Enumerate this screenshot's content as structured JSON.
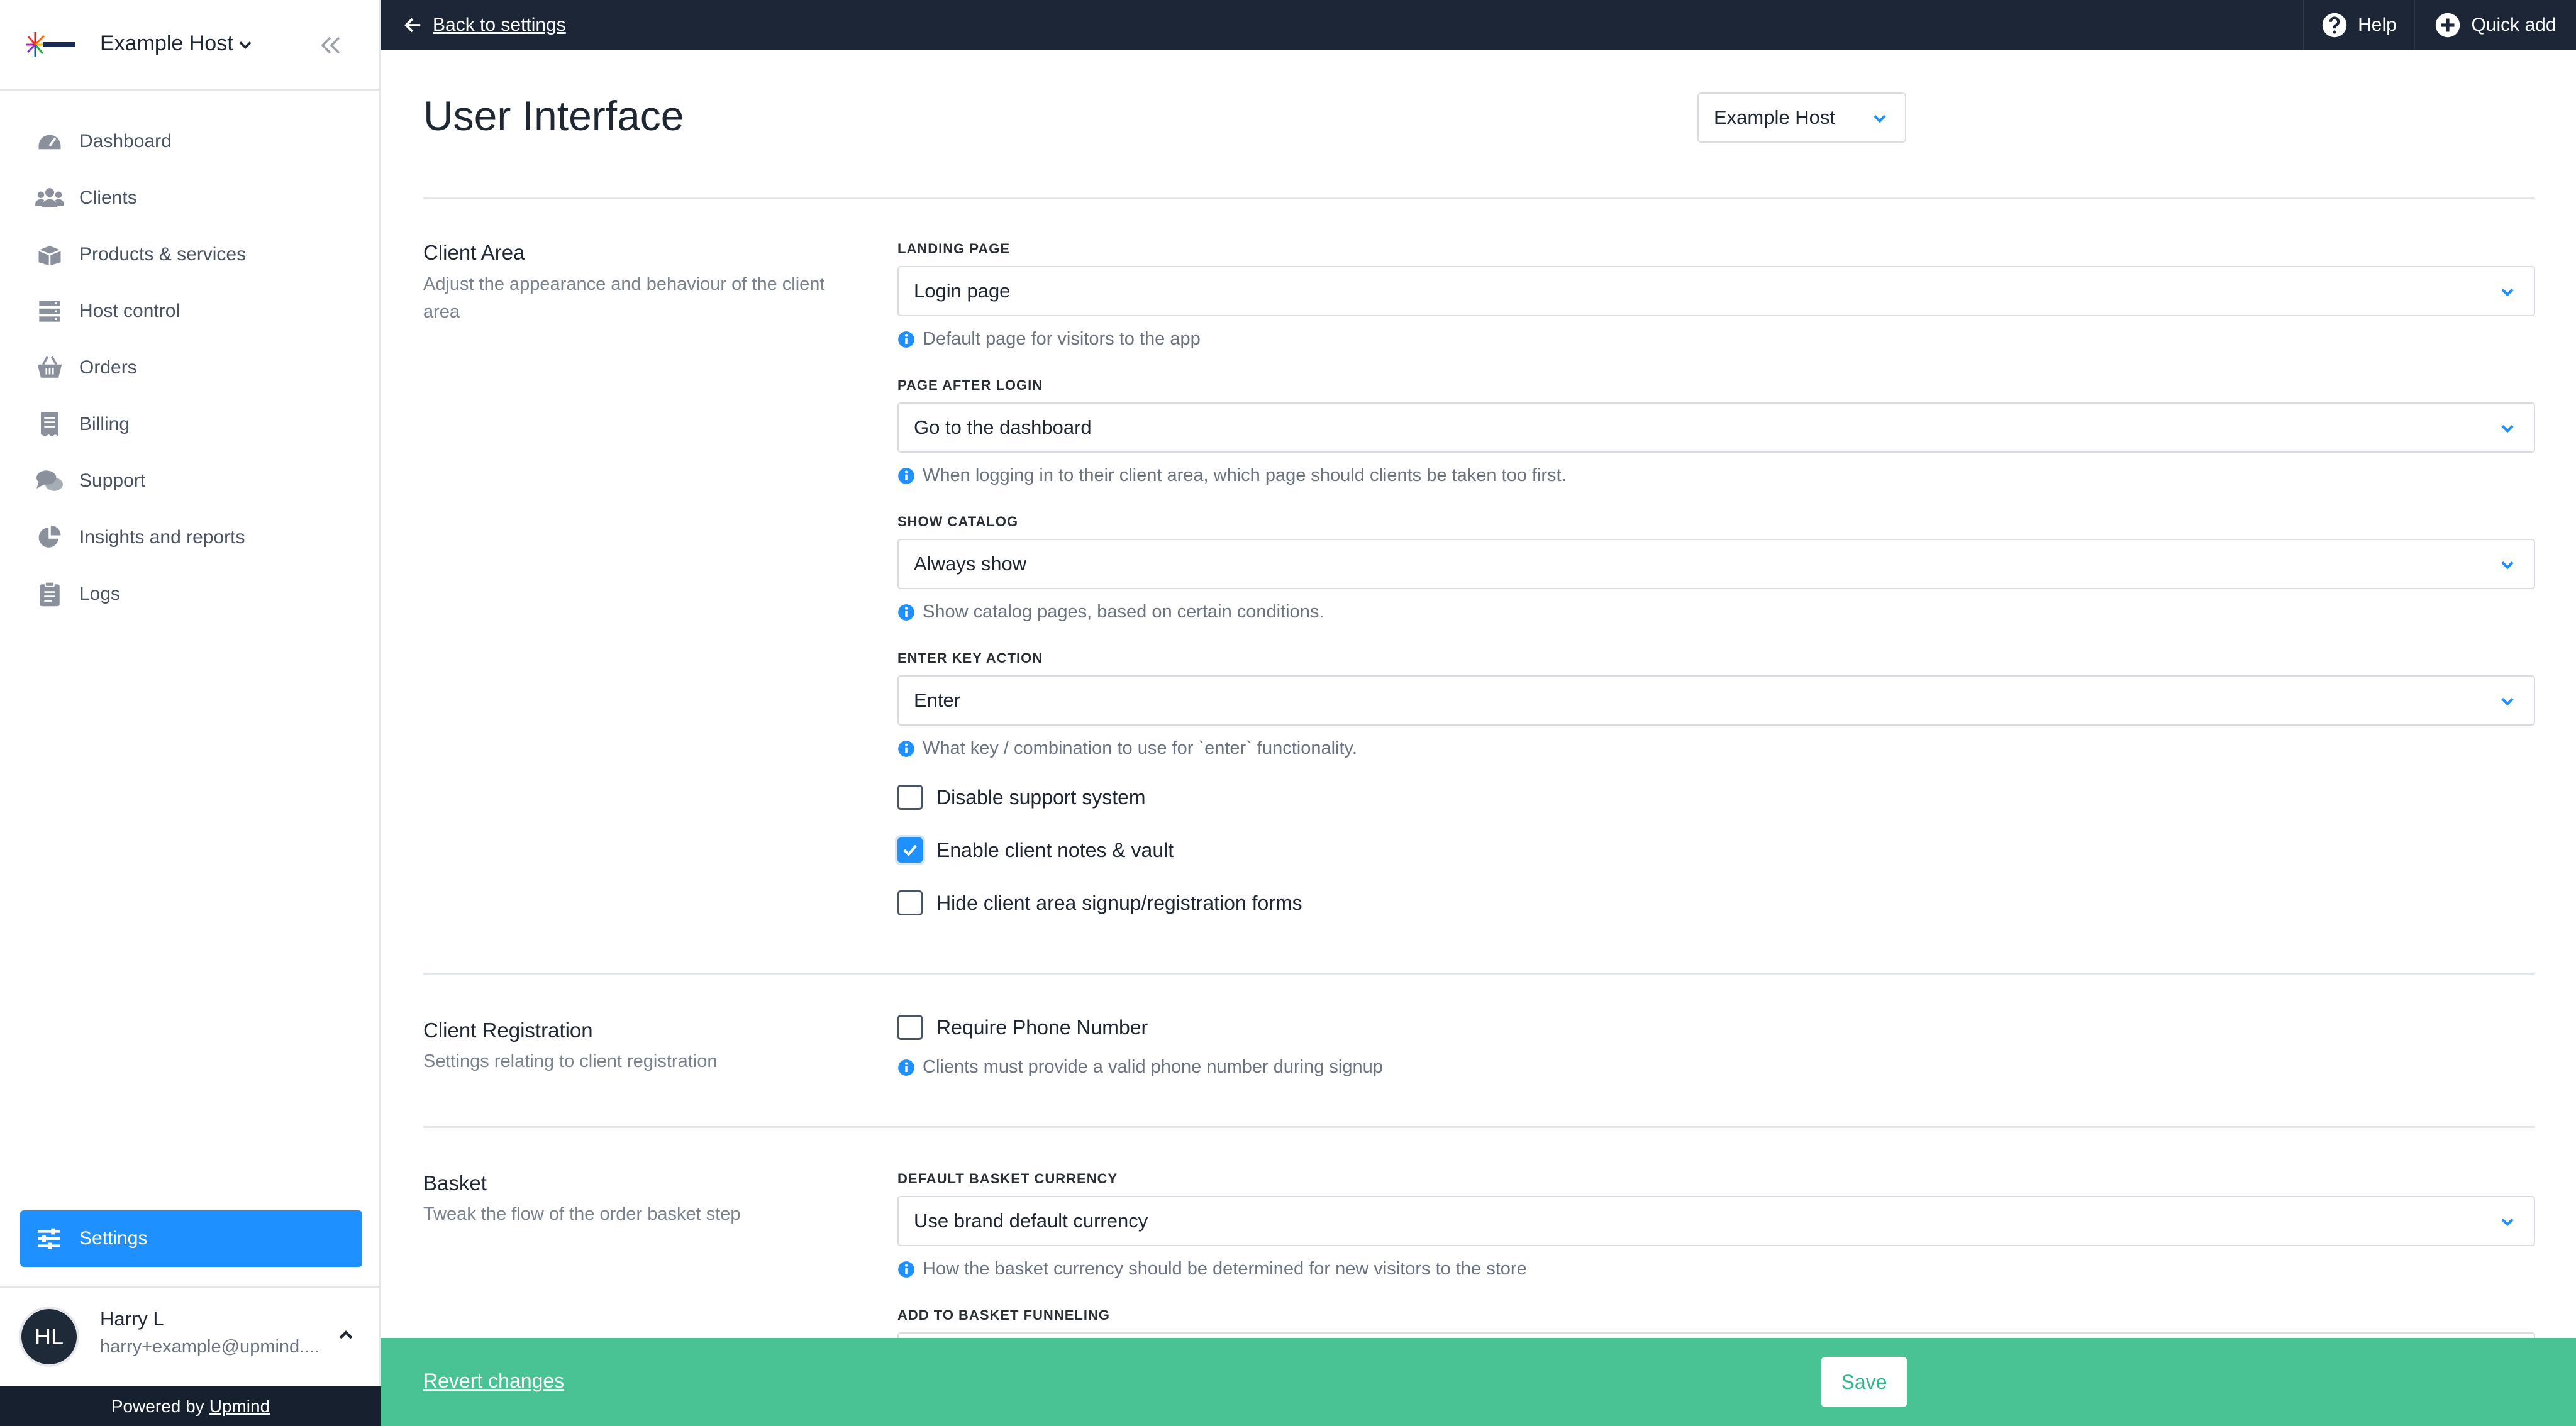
{
  "sidebar": {
    "brand_name": "Example Host",
    "nav": [
      {
        "label": "Dashboard",
        "icon": "dashboard-icon"
      },
      {
        "label": "Clients",
        "icon": "clients-icon"
      },
      {
        "label": "Products & services",
        "icon": "box-icon"
      },
      {
        "label": "Host control",
        "icon": "server-icon"
      },
      {
        "label": "Orders",
        "icon": "basket-icon"
      },
      {
        "label": "Billing",
        "icon": "receipt-icon"
      },
      {
        "label": "Support",
        "icon": "chat-icon"
      },
      {
        "label": "Insights and reports",
        "icon": "pie-chart-icon"
      },
      {
        "label": "Logs",
        "icon": "clipboard-icon"
      }
    ],
    "settings_label": "Settings",
    "user": {
      "initials": "HL",
      "name": "Harry L",
      "email": "harry+example@upmind...."
    },
    "powered_by": "Powered by",
    "powered_link": "Upmind"
  },
  "topbar": {
    "back_label": "Back to settings",
    "help_label": "Help",
    "quick_add_label": "Quick add"
  },
  "main": {
    "title": "User Interface",
    "brand_selector": "Example Host",
    "sections": {
      "client_area": {
        "title": "Client Area",
        "description": "Adjust the appearance and behaviour of the client area",
        "landing_page": {
          "label": "LANDING PAGE",
          "value": "Login page",
          "help": "Default page for visitors to the app"
        },
        "page_after_login": {
          "label": "PAGE AFTER LOGIN",
          "value": "Go to the dashboard",
          "help": "When logging in to their client area, which page should clients be taken too first."
        },
        "show_catalog": {
          "label": "SHOW CATALOG",
          "value": "Always show",
          "help": "Show catalog pages, based on certain conditions."
        },
        "enter_key_action": {
          "label": "ENTER KEY ACTION",
          "value": "Enter",
          "help": "What key / combination to use for `enter` functionality."
        },
        "checkboxes": [
          {
            "label": "Disable support system",
            "checked": false
          },
          {
            "label": "Enable client notes & vault",
            "checked": true
          },
          {
            "label": "Hide client area signup/registration forms",
            "checked": false
          }
        ]
      },
      "client_registration": {
        "title": "Client Registration",
        "description": "Settings relating to client registration",
        "require_phone": {
          "label": "Require Phone Number",
          "checked": false,
          "help": "Clients must provide a valid phone number during signup"
        }
      },
      "basket": {
        "title": "Basket",
        "description": "Tweak the flow of the order basket step",
        "default_currency": {
          "label": "DEFAULT BASKET CURRENCY",
          "value": "Use brand default currency",
          "help": "How the basket currency should be determined for new visitors to the store"
        },
        "funneling": {
          "label": "ADD TO BASKET FUNNELING"
        }
      }
    }
  },
  "footer": {
    "revert_label": "Revert changes",
    "save_label": "Save"
  },
  "colors": {
    "accent": "#1e90ff",
    "topbar": "#1c2636",
    "footer": "#3cbe8c"
  }
}
